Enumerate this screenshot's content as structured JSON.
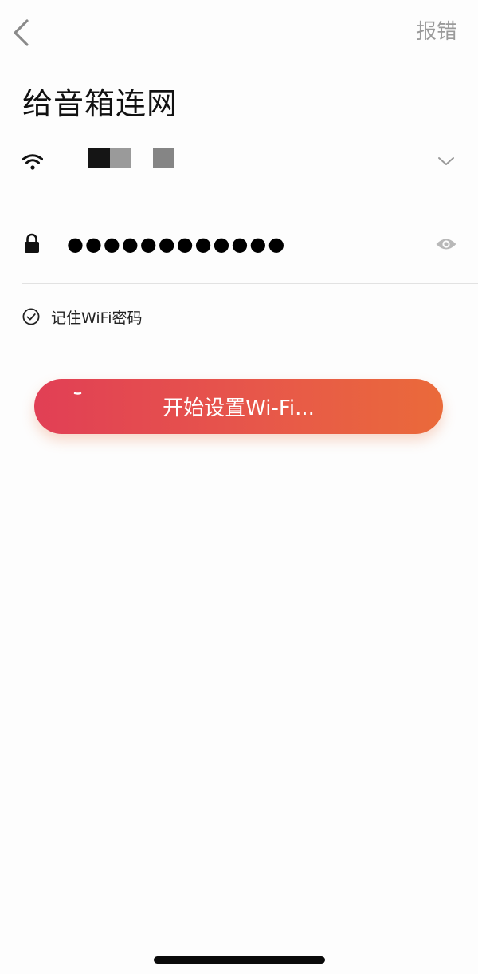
{
  "header": {
    "back_icon": "chevron-left-icon",
    "report_label": "报错"
  },
  "page": {
    "title": "给音箱连网"
  },
  "wifi": {
    "icon": "wifi-icon",
    "dropdown_icon": "chevron-down-icon"
  },
  "password": {
    "icon": "lock-icon",
    "value": "●●●●●●●●●●●●",
    "visibility_icon": "eye-icon"
  },
  "remember": {
    "icon": "check-circle-icon",
    "label": "记住WiFi密码",
    "checked": true
  },
  "start_button": {
    "label": "开始设置Wi-Fi...",
    "gradient_start": "#e13f55",
    "gradient_end": "#ea6a3a"
  }
}
